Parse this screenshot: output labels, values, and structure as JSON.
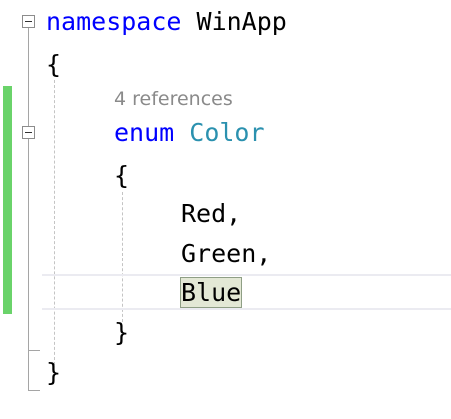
{
  "code": {
    "line1": {
      "keyword": "namespace",
      "name": "WinApp"
    },
    "line2": {
      "text": "{"
    },
    "codelens": "4 references",
    "line3": {
      "keyword": "enum",
      "type": "Color"
    },
    "line4": {
      "text": "{"
    },
    "line5": {
      "text": "Red,"
    },
    "line6": {
      "text": "Green,"
    },
    "line7": {
      "text": "Blue"
    },
    "line8": {
      "text": "}"
    },
    "line9": {
      "text": "}"
    }
  },
  "colors": {
    "keyword": "#0000ff",
    "type": "#2b91af",
    "change_bar": "#6ad36a",
    "codelens": "#8a8a8a"
  }
}
